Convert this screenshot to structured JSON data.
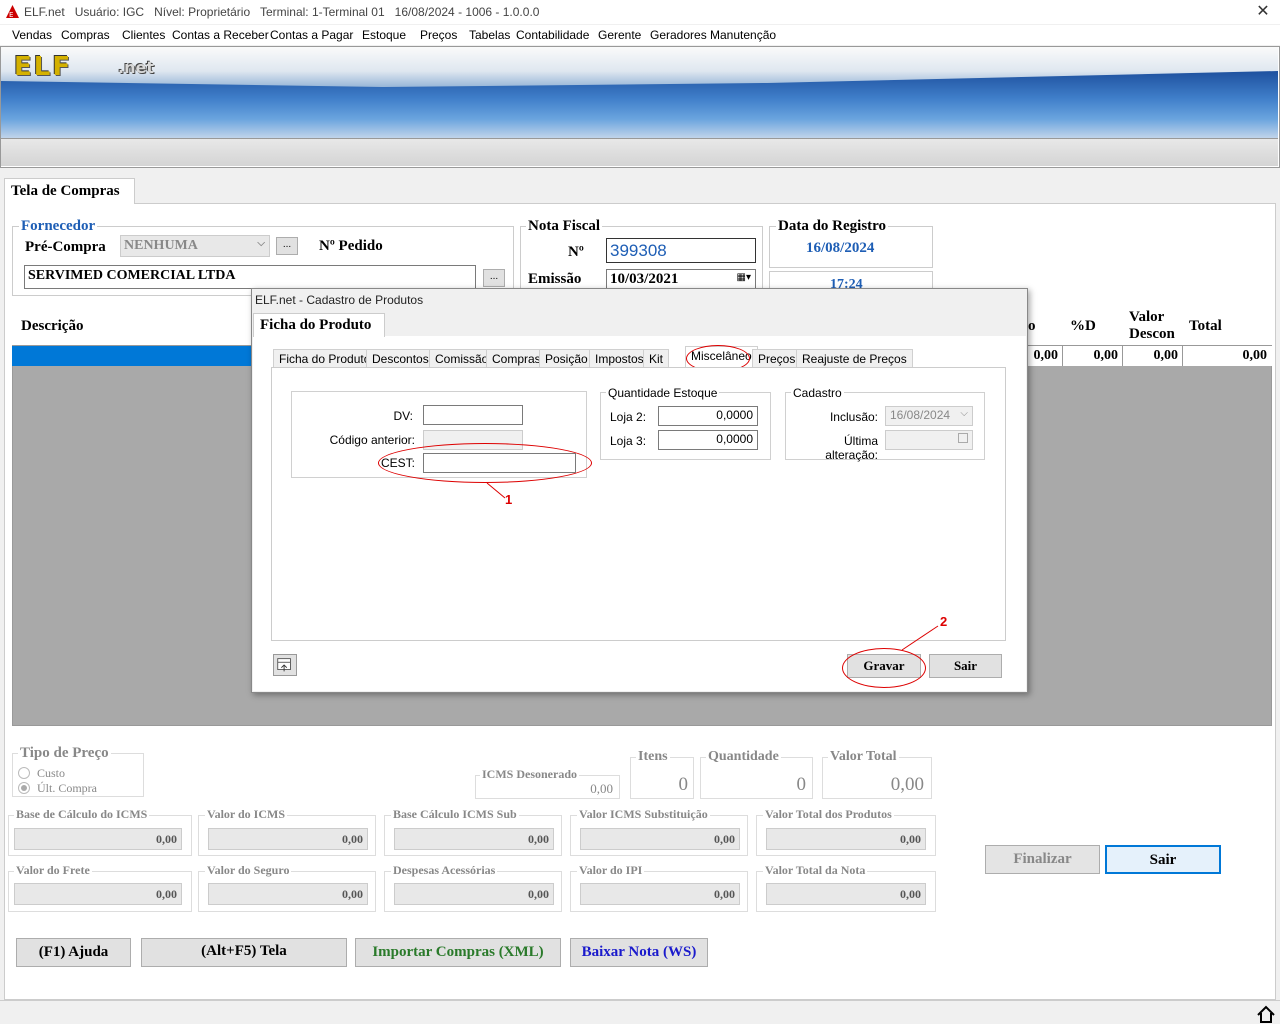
{
  "titlebar": {
    "app": "ELF.net",
    "user": "Usuário: IGC",
    "level": "Nível: Proprietário",
    "terminal": "Terminal: 1-Terminal 01",
    "date_version": "16/08/2024 - 1006 - 1.0.0.0",
    "close": "✕"
  },
  "menu": [
    "Vendas",
    "Compras",
    "Clientes",
    "Contas a Receber",
    "Contas a Pagar",
    "Estoque",
    "Preços",
    "Tabelas",
    "Contabilidade",
    "Gerente",
    "Geradores",
    "Manutenção"
  ],
  "logo": {
    "main": "ELF",
    "suffix": ".net"
  },
  "main_tab": "Tela de Compras",
  "fornecedor": {
    "legend": "Fornecedor",
    "pre_compra_label": "Pré-Compra",
    "pre_compra_value": "NENHUMA",
    "pedido_label": "Nº Pedido",
    "supplier_name": "SERVIMED COMERCIAL LTDA",
    "ellipsis": "..."
  },
  "nota_fiscal": {
    "legend": "Nota Fiscal",
    "numero_label": "Nº",
    "numero_value": "399308",
    "emissao_label": "Emissão",
    "emissao_value": "10/03/2021"
  },
  "registro": {
    "legend": "Data do Registro",
    "date": "16/08/2024",
    "time": "17:24"
  },
  "grid": {
    "headers": {
      "descricao": "Descrição",
      "o": "o",
      "pd": "%D",
      "valor_descon_1": "Valor",
      "valor_descon_2": "Descon",
      "total": "Total"
    },
    "row": [
      "0,00",
      "0,00",
      "0,00",
      "0,00"
    ]
  },
  "dialog": {
    "title": "ELF.net - Cadastro de Produtos",
    "tab": "Ficha do Produto",
    "subtabs": [
      "Ficha do Produto",
      "Descontos",
      "Comissão",
      "Compras",
      "Posição",
      "Impostos",
      "Kit",
      "Miscelâneo",
      "Preços",
      "Reajuste de Preços"
    ],
    "misc": {
      "dv_label": "DV:",
      "codigo_anterior_label": "Código anterior:",
      "cest_label": "CEST:"
    },
    "estoque": {
      "legend": "Quantidade Estoque",
      "loja2_label": "Loja 2:",
      "loja2_value": "0,0000",
      "loja3_label": "Loja 3:",
      "loja3_value": "0,0000"
    },
    "cadastro": {
      "legend": "Cadastro",
      "inclusao_label": "Inclusão:",
      "inclusao_value": "16/08/2024",
      "ultima_label": "Última alteração:"
    },
    "annotation_1": "1",
    "annotation_2": "2",
    "gravar": "Gravar",
    "sair": "Sair"
  },
  "tipo_preco": {
    "legend": "Tipo de Preço",
    "custo": "Custo",
    "ult_compra": "Últ. Compra"
  },
  "totals": {
    "icms_desonerado_label": "ICMS Desonerado",
    "icms_desonerado": "0,00",
    "itens_label": "Itens",
    "itens": "0",
    "quantidade_label": "Quantidade",
    "quantidade": "0",
    "valor_total_label": "Valor Total",
    "valor_total": "0,00"
  },
  "fields": [
    {
      "label": "Base de Cálculo do ICMS",
      "value": "0,00"
    },
    {
      "label": "Valor do ICMS",
      "value": "0,00"
    },
    {
      "label": "Base Cálculo ICMS Sub",
      "value": "0,00"
    },
    {
      "label": "Valor ICMS Substituição",
      "value": "0,00"
    },
    {
      "label": "Valor Total dos Produtos",
      "value": "0,00"
    },
    {
      "label": "Valor do Frete",
      "value": "0,00"
    },
    {
      "label": "Valor do Seguro",
      "value": "0,00"
    },
    {
      "label": "Despesas Acessórias",
      "value": "0,00"
    },
    {
      "label": "Valor do IPI",
      "value": "0,00"
    },
    {
      "label": "Valor Total da Nota",
      "value": "0,00"
    }
  ],
  "buttons": {
    "finalizar": "Finalizar",
    "sair": "Sair",
    "ajuda": "(F1) Ajuda",
    "tela": "(Alt+F5) Tela",
    "importar": "Importar Compras (XML)",
    "baixar": "Baixar Nota (WS)"
  },
  "colors": {
    "accent_blue": "#0078d7",
    "annotation_red": "#d00000",
    "import_green": "#2a7a2a",
    "baixar_blue": "#1a1acc"
  }
}
